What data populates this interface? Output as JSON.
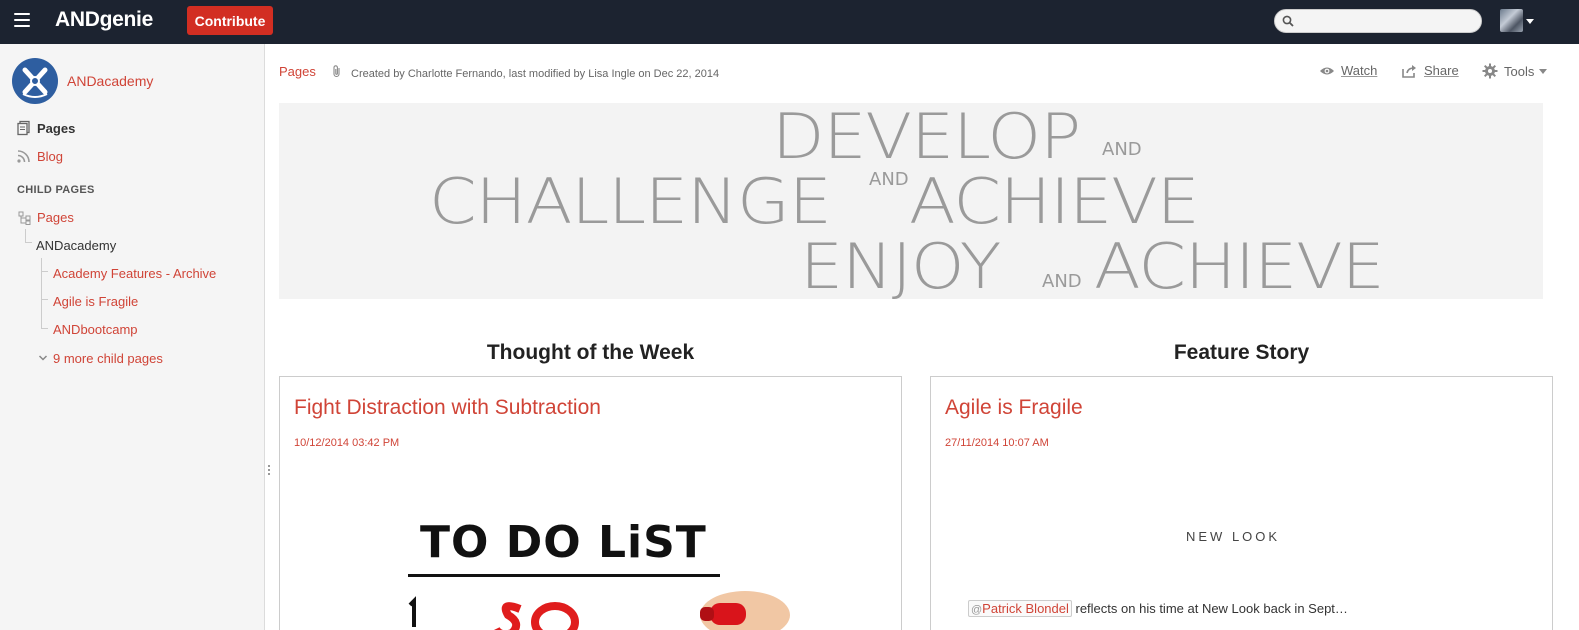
{
  "header": {
    "brand": "ANDgenie",
    "contribute_label": "Contribute",
    "search_placeholder": ""
  },
  "sidebar": {
    "space_name": "ANDacademy",
    "nav": [
      {
        "label": "Pages",
        "icon": "pages-icon"
      },
      {
        "label": "Blog",
        "icon": "rss-icon"
      }
    ],
    "child_heading": "CHILD PAGES",
    "tree": {
      "root": "Pages",
      "parent": "ANDacademy",
      "children": [
        "Academy Features - Archive",
        "Agile is Fragile",
        "ANDbootcamp"
      ],
      "more": "9 more child pages"
    }
  },
  "page": {
    "breadcrumb": "Pages",
    "byline": "Created by Charlotte Fernando, last modified by Lisa Ingle on Dec 22, 2014",
    "actions": {
      "watch": "Watch",
      "share": "Share",
      "tools": "Tools"
    }
  },
  "banner": {
    "line1": "DEVELOP",
    "line1_and": "AND",
    "line2a": "CHALLENGE",
    "line2_and": "AND",
    "line2b": "ACHIEVE",
    "line3a": "ENJOY",
    "line3_and": "AND",
    "line3b": "ACHIEVE"
  },
  "columns": {
    "left": {
      "heading": "Thought of the Week",
      "post_title": "Fight Distraction with Subtraction",
      "post_date": "10/12/2014 03:42 PM",
      "image_text": "TO DO LiST"
    },
    "right": {
      "heading": "Feature Story",
      "post_title": "Agile is Fragile",
      "post_date": "27/11/2014 10:07 AM",
      "image_text": "NEW LOOK",
      "mention_name": "Patrick Blondel",
      "mention_rest": " reflects on his time at New Look back in Sept…"
    }
  },
  "colors": {
    "topbar": "#1c2330",
    "accent_red": "#d04437",
    "contribute_red": "#d22e22",
    "space_blue": "#2e5ea0"
  }
}
